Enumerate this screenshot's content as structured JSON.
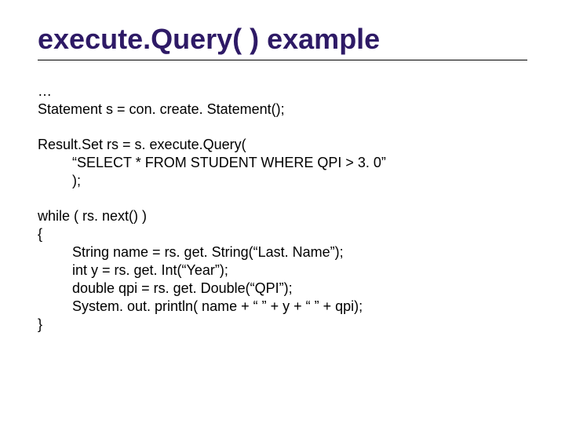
{
  "title": "execute.Query( ) example",
  "code": {
    "ellipsis": "…",
    "stmt_decl": "Statement s = con. create. Statement();",
    "rs_decl": "Result.Set rs = s. execute.Query(",
    "rs_sql": "“SELECT * FROM STUDENT WHERE QPI > 3. 0”",
    "rs_close": ");",
    "while_line": "while ( rs. next() )",
    "brace_open": "{",
    "line_name": "String name = rs. get. String(“Last. Name”);",
    "line_year": "int y = rs. get. Int(“Year”);",
    "line_qpi": "double qpi = rs. get. Double(“QPI”);",
    "line_print": "System. out. println( name + “ ” + y + “ ” + qpi);",
    "brace_close": "}"
  }
}
